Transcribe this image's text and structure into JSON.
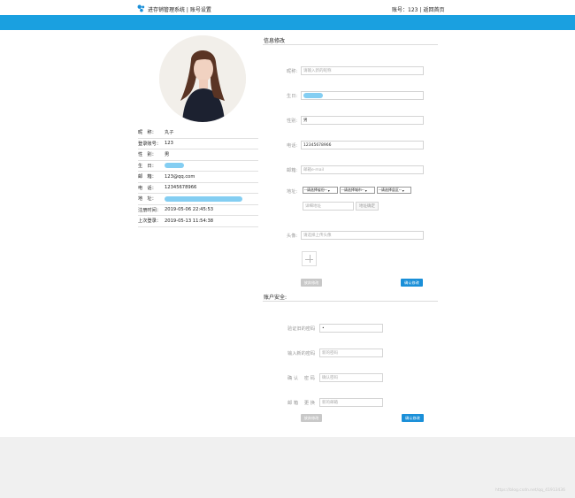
{
  "header": {
    "app_title": "进存销管理系统 | 账号设置",
    "account_label": "账号：123",
    "separator": "|",
    "back_link": "返回首页"
  },
  "profile": {
    "rows": [
      {
        "label": "昵　称：",
        "value": "丸子"
      },
      {
        "label": "登录账号：",
        "value": "123"
      },
      {
        "label": "性　别：",
        "value": "男"
      },
      {
        "label": "生　日：",
        "value": ""
      },
      {
        "label": "邮　箱：",
        "value": "123@qq.com"
      },
      {
        "label": "电　话：",
        "value": "12345678966"
      },
      {
        "label": "地　址：",
        "value": ""
      },
      {
        "label": "注册时间：",
        "value": "2019-05-06 22:45:53"
      },
      {
        "label": "上次登录：",
        "value": "2019-05-13 11:54:38"
      }
    ]
  },
  "info_form": {
    "title": "信息修改",
    "nickname": {
      "label": "昵称:",
      "placeholder": "请输入新的昵称"
    },
    "birthday": {
      "label": "生日:",
      "value": ""
    },
    "gender": {
      "label": "性别:",
      "value": "男"
    },
    "phone": {
      "label": "电话:",
      "value": "12345678966"
    },
    "email": {
      "label": "邮箱:",
      "placeholder": "邮箱e-mail"
    },
    "address": {
      "label": "地址:",
      "province": "--请选择省份--",
      "city": "--请选择城市--",
      "district": "--请选择县区--",
      "detail_placeholder": "详细地址",
      "confirm_button": "地址确定"
    },
    "avatar": {
      "label": "头像:",
      "placeholder": "请选择上传头像"
    },
    "cancel_button": "放弃修改",
    "submit_button": "确认修改"
  },
  "security_form": {
    "title": "账户安全:",
    "old_password": {
      "label": "验证旧的密码",
      "value": "•"
    },
    "new_password": {
      "label": "输入新的密码",
      "placeholder": "新的密码"
    },
    "confirm_password": {
      "label": "确 认 　密 码",
      "placeholder": "确认密码"
    },
    "new_email": {
      "label": "邮 箱 　更 换",
      "placeholder": "新的邮箱"
    },
    "cancel_button": "放弃修改",
    "submit_button": "确认修改"
  },
  "watermark": "https://blog.csdn.net/qq_41913436",
  "colors": {
    "accent": "#1aa0e0",
    "button": "#1a8fd8"
  }
}
